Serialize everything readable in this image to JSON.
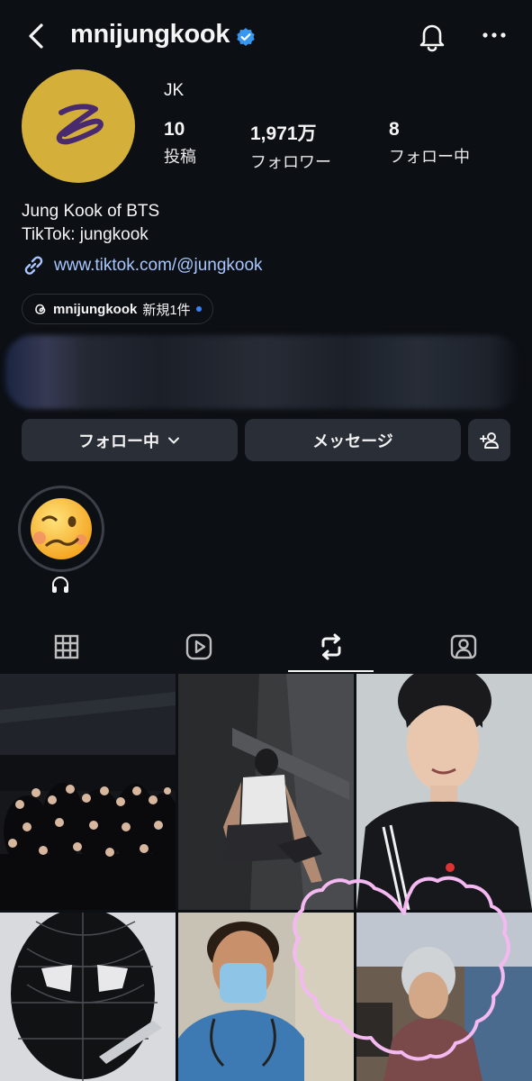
{
  "header": {
    "username": "mnijungkook",
    "icons": [
      "back-chevron-icon",
      "verified-badge-icon",
      "bell-icon",
      "more-icon"
    ]
  },
  "profile": {
    "display_name": "JK",
    "stats": [
      {
        "value": "10",
        "label": "投稿"
      },
      {
        "value": "1,971万",
        "label": "フォロワー"
      },
      {
        "value": "8",
        "label": "フォロー中"
      }
    ],
    "bio_line1": "Jung Kook of BTS",
    "bio_line2": "TikTok: jungkook",
    "link_url": "www.tiktok.com/@jungkook",
    "threads_user": "mnijungkook",
    "threads_badge": "新規1件"
  },
  "actions": {
    "following_label": "フォロー中",
    "message_label": "メッセージ"
  },
  "highlight": {
    "emoji": "🥴",
    "caption_icon": "headphones-icon"
  },
  "tabs": [
    "grid-icon",
    "reels-icon",
    "reposts-icon",
    "tagged-icon"
  ],
  "selected_tab": 2,
  "colors": {
    "background": "#0c0f14",
    "button": "#2a2e36",
    "link": "#a7c6ff",
    "verified": "#3897f0",
    "avatar": "#d4b03a",
    "logo": "#4a2a6e",
    "heart_outline": "#f3b9f0"
  },
  "grid_posts": [
    "group-photo-dancers",
    "man-sitting-tattoo",
    "selfie-black-track-jacket",
    "black-spider-mask",
    "doctor-scrubs-mask",
    "silver-hair-street-photo"
  ]
}
